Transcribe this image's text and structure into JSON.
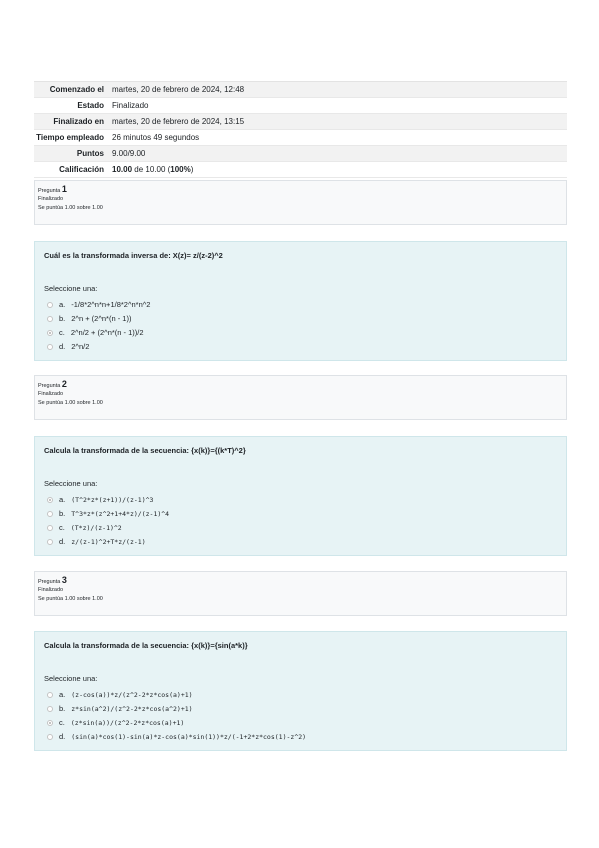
{
  "summary": [
    {
      "key": "Comenzado el",
      "value": "martes, 20 de febrero de 2024, 12:48"
    },
    {
      "key": "Estado",
      "value": "Finalizado"
    },
    {
      "key": "Finalizado en",
      "value": "martes, 20 de febrero de 2024, 13:15"
    },
    {
      "key": "Tiempo empleado",
      "value": "26 minutos 49 segundos"
    },
    {
      "key": "Puntos",
      "value": "9.00/9.00"
    },
    {
      "key": "Calificación",
      "value_bold": "10.00",
      "value_mid": " de 10.00 (",
      "value_pct": "100%",
      "value_end": ")"
    }
  ],
  "questions": [
    {
      "label": "Pregunta",
      "number": "1",
      "state": "Finalizado",
      "grade": "Se puntúa 1.00 sobre 1.00",
      "text": "Cuál es la transformada inversa de: X(z)= z/(z-2)^2",
      "prompt": "Seleccione una:",
      "options": [
        {
          "letter": "a.",
          "text": "-1/8*2^n*n+1/8*2^n*n^2",
          "checked": false
        },
        {
          "letter": "b.",
          "text": "2^n + (2^n*(n - 1))",
          "checked": false
        },
        {
          "letter": "c.",
          "text": "2^n/2 + (2^n*(n - 1))/2",
          "checked": true
        },
        {
          "letter": "d.",
          "text": "2^n/2",
          "checked": false
        }
      ]
    },
    {
      "label": "Pregunta",
      "number": "2",
      "state": "Finalizado",
      "grade": "Se puntúa 1.00 sobre 1.00",
      "text": "Calcula la transformada de la secuencia: {x(k)}={(k*T)^2}",
      "prompt": "Seleccione una:",
      "options": [
        {
          "letter": "a.",
          "text": "(T^2*z*(z+1))/(z-1)^3",
          "checked": true
        },
        {
          "letter": "b.",
          "text": "T^3*z*(z^2+1+4*z)/(z-1)^4",
          "checked": false
        },
        {
          "letter": "c.",
          "text": "(T*z)/(z-1)^2",
          "checked": false
        },
        {
          "letter": "d.",
          "text": "z/(z-1)^2+T*z/(z-1)",
          "checked": false
        }
      ]
    },
    {
      "label": "Pregunta",
      "number": "3",
      "state": "Finalizado",
      "grade": "Se puntúa 1.00 sobre 1.00",
      "text": "Calcula la transformada de la secuencia: {x(k)}={sin(a*k)}",
      "prompt": "Seleccione una:",
      "options": [
        {
          "letter": "a.",
          "text": "(z-cos(a))*z/(z^2-2*z*cos(a)+1)",
          "checked": false
        },
        {
          "letter": "b.",
          "text": "z*sin(a^2)/(z^2-2*z*cos(a^2)+1)",
          "checked": false
        },
        {
          "letter": "c.",
          "text": "(z*sin(a))/(z^2-2*z*cos(a)+1)",
          "checked": true
        },
        {
          "letter": "d.",
          "text": "(sin(a)*cos(1)-sin(a)*z-cos(a)*sin(1))*z/(-1+2*z*cos(1)-z^2)",
          "checked": false
        }
      ]
    }
  ]
}
